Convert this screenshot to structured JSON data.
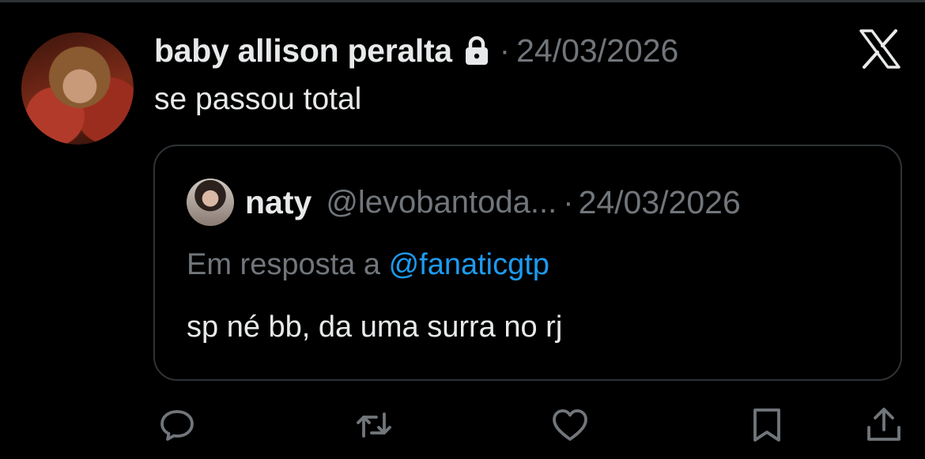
{
  "tweet": {
    "author_name": "baby allison peralta",
    "date": "24/03/2026",
    "text": "se passou total",
    "icons": {
      "lock": "lock-icon",
      "platform": "x-logo-icon"
    }
  },
  "quoted": {
    "name": "naty",
    "handle": "@levobantoda...",
    "date": "24/03/2026",
    "reply_prefix": "Em resposta a",
    "reply_mention": "@fanaticgtp",
    "text": "sp né bb, da uma surra no rj"
  },
  "separator": "·",
  "actions": [
    "reply-icon",
    "retweet-icon",
    "like-icon",
    "bookmark-icon",
    "share-icon"
  ],
  "colors": {
    "background": "#000000",
    "text": "#e7e9ea",
    "muted": "#71767b",
    "link": "#1d9bf0",
    "border": "#2f3336"
  }
}
